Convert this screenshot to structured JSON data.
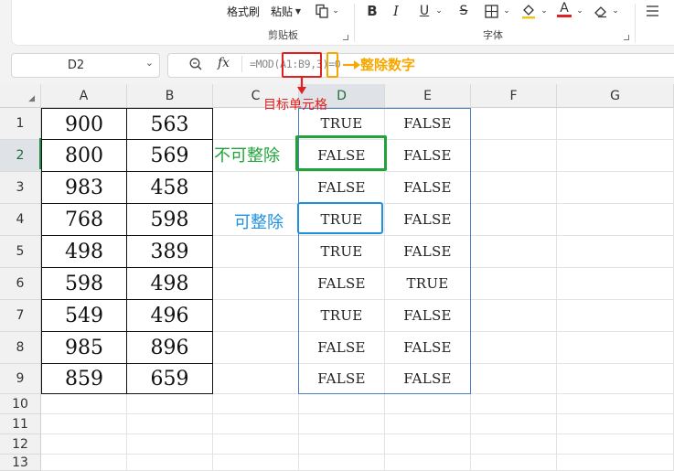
{
  "ribbon": {
    "format_painter": "格式刷",
    "paste": "粘贴",
    "clipboard_group": "剪贴板",
    "font_group": "字体",
    "bold": "B",
    "italic": "I",
    "underline": "U",
    "strikethrough": "S",
    "font_color_glyph": "A"
  },
  "formula_bar": {
    "name_box": "D2",
    "fx_label": "fx",
    "formula": "=MOD(A1:B9,3)=0"
  },
  "columns": [
    "A",
    "B",
    "C",
    "D",
    "E",
    "F",
    "G"
  ],
  "rows": [
    "1",
    "2",
    "3",
    "4",
    "5",
    "6",
    "7",
    "8",
    "9",
    "10",
    "11",
    "12",
    "13"
  ],
  "col_a": [
    "900",
    "800",
    "983",
    "768",
    "498",
    "598",
    "549",
    "985",
    "859"
  ],
  "col_b": [
    "563",
    "569",
    "458",
    "598",
    "389",
    "498",
    "496",
    "896",
    "659"
  ],
  "col_d": [
    "TRUE",
    "FALSE",
    "FALSE",
    "TRUE",
    "TRUE",
    "FALSE",
    "TRUE",
    "FALSE",
    "FALSE"
  ],
  "col_e": [
    "FALSE",
    "FALSE",
    "FALSE",
    "FALSE",
    "FALSE",
    "TRUE",
    "FALSE",
    "FALSE",
    "FALSE"
  ],
  "annotations": {
    "target_cell": "目标单元格",
    "divisor": "整除数字",
    "not_divisible": "不可整除",
    "divisible": "可整除"
  },
  "colors": {
    "red": "#e02020",
    "orange": "#f5a800",
    "green": "#1fa33a",
    "blue": "#1e90e0",
    "result_border": "#4a7fc0"
  }
}
